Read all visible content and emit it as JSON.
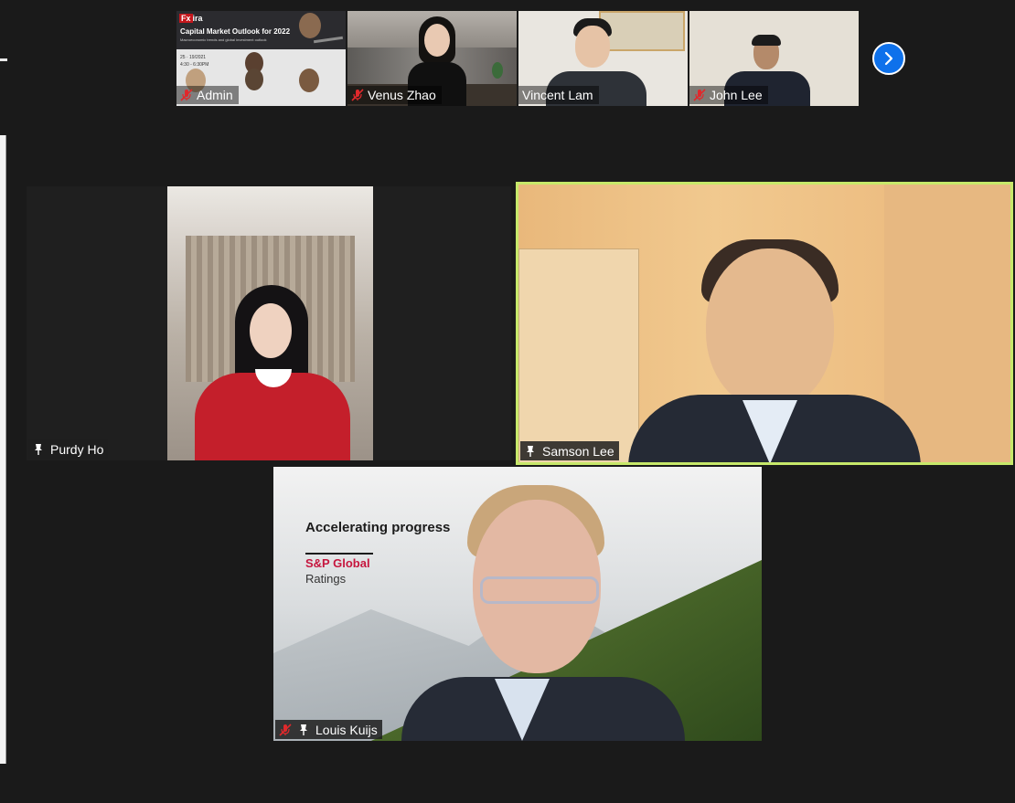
{
  "thumbnails": [
    {
      "name": "Admin",
      "muted": true
    },
    {
      "name": "Venus Zhao",
      "muted": true
    },
    {
      "name": "Vincent Lam",
      "muted": false
    },
    {
      "name": "John Lee",
      "muted": true
    }
  ],
  "poster": {
    "logo": "ira",
    "title": "Capital Market Outlook for 2022",
    "subtitle": "Macroeconomic trends and global investment outlook",
    "date": "25 · 19/2021",
    "time": "4:30 - 6:30PM"
  },
  "tiles": [
    {
      "name": "Purdy Ho",
      "pinned": true,
      "muted": false,
      "active": false
    },
    {
      "name": "Samson Lee",
      "pinned": true,
      "muted": false,
      "active": true
    },
    {
      "name": "Louis Kuijs",
      "pinned": true,
      "muted": true,
      "active": false
    }
  ],
  "louis_background": {
    "headline": "Accelerating progress",
    "brand_line1": "S&P Global",
    "brand_line2": "Ratings"
  },
  "colors": {
    "active_outline": "#c7e86a",
    "next_button": "#0e71eb",
    "mic_off": "#e0292c",
    "brand_red": "#c6163e"
  }
}
